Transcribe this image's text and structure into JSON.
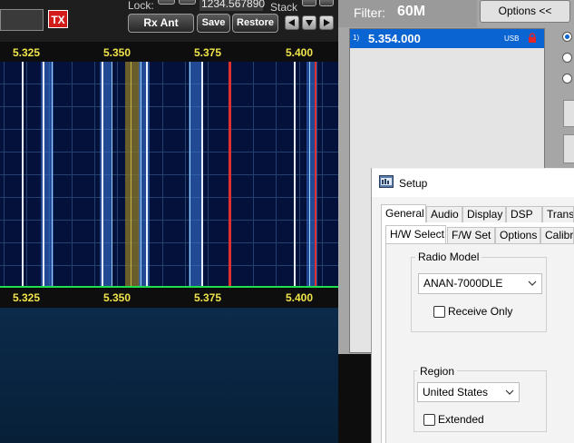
{
  "top": {
    "tx_label": "TX",
    "lock_label": "Lock:",
    "freq_display": "1234.567890",
    "stack_label": "Stack",
    "rx_ant_label": "Rx Ant",
    "save_label": "Save",
    "restore_label": "Restore"
  },
  "panadapter": {
    "freq_labels": [
      "5.325",
      "5.350",
      "5.375",
      "5.400"
    ]
  },
  "filter": {
    "label": "Filter:",
    "value": "60M",
    "options_label": "Options <<"
  },
  "memory": {
    "rows": [
      {
        "index": "1)",
        "freq": "5.354.000",
        "mode": "USB",
        "locked": true
      }
    ]
  },
  "setup": {
    "title": "Setup",
    "tabs": [
      "General",
      "Audio",
      "Display",
      "DSP",
      "Transm"
    ],
    "selected_tab": "General",
    "subtabs": [
      "H/W Select",
      "F/W Set",
      "Options",
      "Calibrat"
    ],
    "selected_subtab": "H/W Select",
    "radio_model_label": "Radio Model",
    "radio_model_value": "ANAN-7000DLE",
    "receive_only_label": "Receive Only",
    "receive_only_checked": false,
    "region_label": "Region",
    "region_value": "United States",
    "extended_label": "Extended",
    "extended_checked": false
  },
  "colors": {
    "freq_label": "#f0e44a",
    "panadapter_bg": "#04113a",
    "baseline": "#1ee04c",
    "memory_selected": "#0a64d2",
    "tx_button": "#d21c1c"
  }
}
